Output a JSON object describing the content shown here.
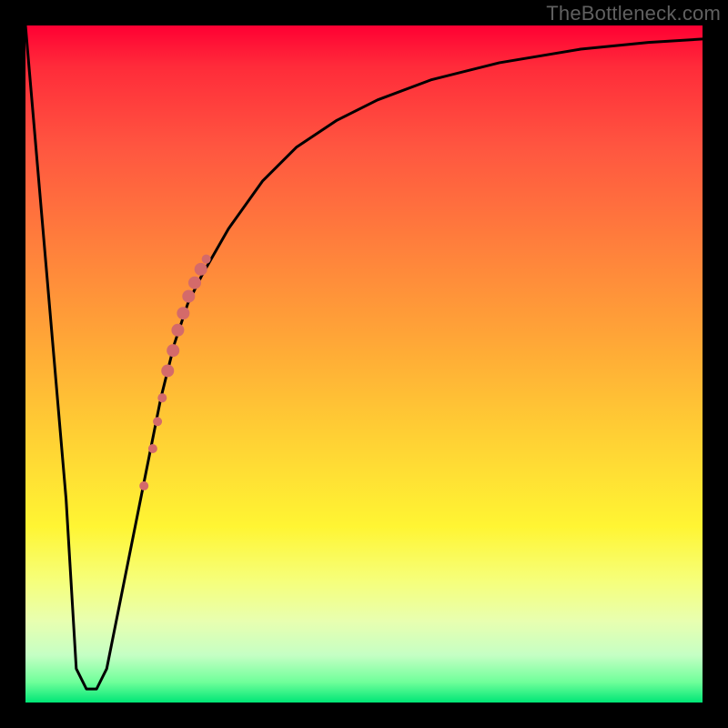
{
  "watermark": {
    "text": "TheBottleneck.com"
  },
  "chart_data": {
    "type": "line",
    "title": "",
    "xlabel": "",
    "ylabel": "",
    "xlim": [
      0,
      100
    ],
    "ylim": [
      0,
      100
    ],
    "grid": false,
    "legend": false,
    "background": "vertical-gradient-red-to-green",
    "series": [
      {
        "name": "bottleneck-curve",
        "x": [
          0,
          3,
          6,
          7.5,
          9.0,
          10.5,
          12,
          15,
          18,
          20,
          22,
          24,
          26,
          30,
          35,
          40,
          46,
          52,
          60,
          70,
          82,
          92,
          100
        ],
        "y": [
          100,
          65,
          30,
          5,
          2,
          2,
          5,
          20,
          35,
          45,
          53,
          59,
          63,
          70,
          77,
          82,
          86,
          89,
          92,
          94.5,
          96.5,
          97.5,
          98
        ]
      }
    ],
    "markers": [
      {
        "x": 17.5,
        "y": 32,
        "r": 5,
        "color": "#d46a6a"
      },
      {
        "x": 18.8,
        "y": 37.5,
        "r": 5,
        "color": "#d46a6a"
      },
      {
        "x": 19.5,
        "y": 41.5,
        "r": 5,
        "color": "#d46a6a"
      },
      {
        "x": 20.2,
        "y": 45,
        "r": 5,
        "color": "#d46a6a"
      },
      {
        "x": 21.0,
        "y": 49,
        "r": 7,
        "color": "#d46a6a"
      },
      {
        "x": 21.8,
        "y": 52,
        "r": 7,
        "color": "#d46a6a"
      },
      {
        "x": 22.5,
        "y": 55,
        "r": 7,
        "color": "#d46a6a"
      },
      {
        "x": 23.3,
        "y": 57.5,
        "r": 7,
        "color": "#d46a6a"
      },
      {
        "x": 24.1,
        "y": 60,
        "r": 7,
        "color": "#d46a6a"
      },
      {
        "x": 25.0,
        "y": 62,
        "r": 7,
        "color": "#d46a6a"
      },
      {
        "x": 25.9,
        "y": 64,
        "r": 7,
        "color": "#d46a6a"
      },
      {
        "x": 26.7,
        "y": 65.5,
        "r": 5,
        "color": "#d46a6a"
      }
    ],
    "annotations": []
  }
}
